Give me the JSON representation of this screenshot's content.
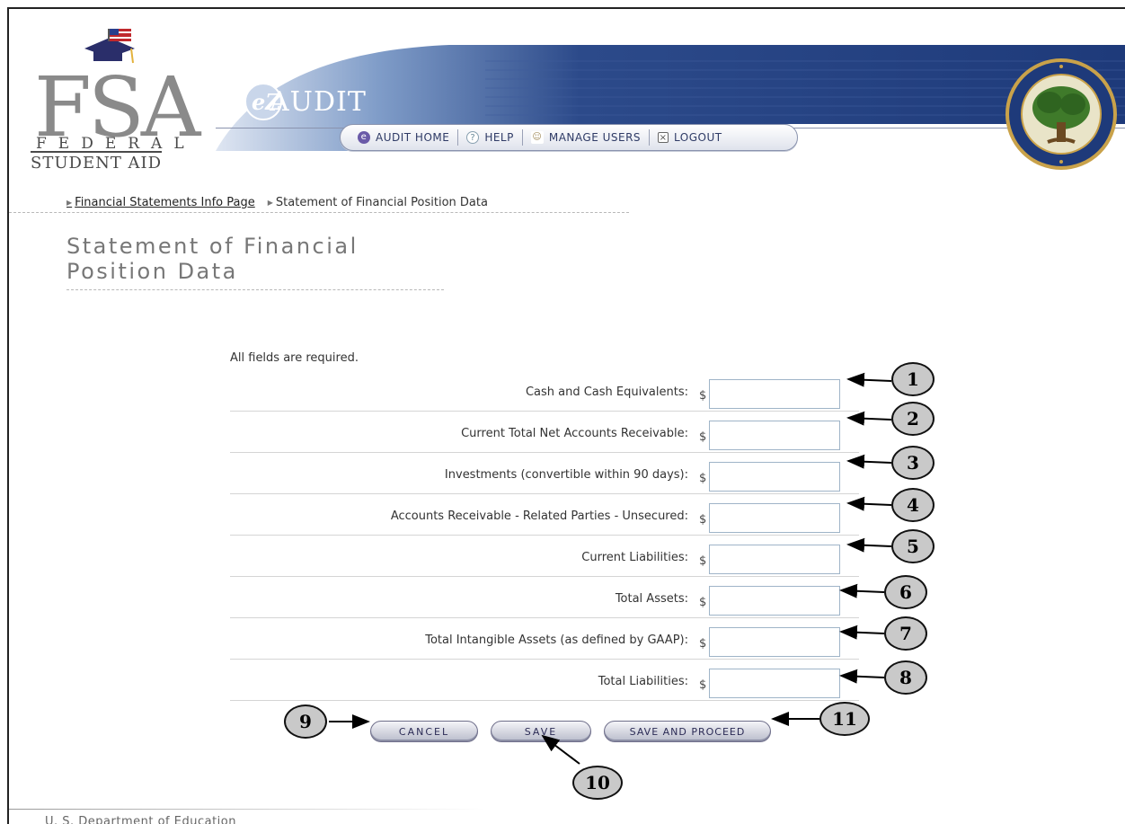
{
  "header": {
    "logo_letters": "FSA",
    "logo_federal": "FEDERAL",
    "logo_student_aid": "STUDENT AID",
    "app_title": "AUDIT",
    "app_badge": "eZ",
    "nav": [
      {
        "label": "AUDIT HOME",
        "icon": "home-icon"
      },
      {
        "label": "HELP",
        "icon": "help-icon"
      },
      {
        "label": "MANAGE USERS",
        "icon": "users-icon"
      },
      {
        "label": "LOGOUT",
        "icon": "logout-icon"
      }
    ],
    "seal_text": "DEPARTMENT OF EDUCATION"
  },
  "breadcrumb": {
    "items": [
      "Financial Statements Info Page",
      "Statement of Financial Position Data"
    ]
  },
  "page": {
    "title": "Statement of Financial Position Data",
    "required_note": "All fields are required."
  },
  "form": {
    "currency_symbol": "$",
    "fields": [
      {
        "label": "Cash and Cash Equivalents:",
        "value": "",
        "callout": "1"
      },
      {
        "label": "Current Total Net Accounts Receivable:",
        "value": "",
        "callout": "2"
      },
      {
        "label": "Investments (convertible within 90 days):",
        "value": "",
        "callout": "3"
      },
      {
        "label": "Accounts Receivable - Related Parties - Unsecured:",
        "value": "",
        "callout": "4"
      },
      {
        "label": "Current Liabilities:",
        "value": "",
        "callout": "5"
      },
      {
        "label": "Total Assets:",
        "value": "",
        "callout": "6"
      },
      {
        "label": "Total Intangible Assets (as defined by GAAP):",
        "value": "",
        "callout": "7"
      },
      {
        "label": "Total Liabilities:",
        "value": "",
        "callout": "8"
      }
    ]
  },
  "buttons": {
    "cancel": "CANCEL",
    "save": "SAVE",
    "save_and_proceed": "SAVE AND PROCEED"
  },
  "callouts": {
    "cancel": "9",
    "save": "10",
    "save_and_proceed": "11"
  },
  "footer": {
    "text": "U. S. Department of Education"
  }
}
